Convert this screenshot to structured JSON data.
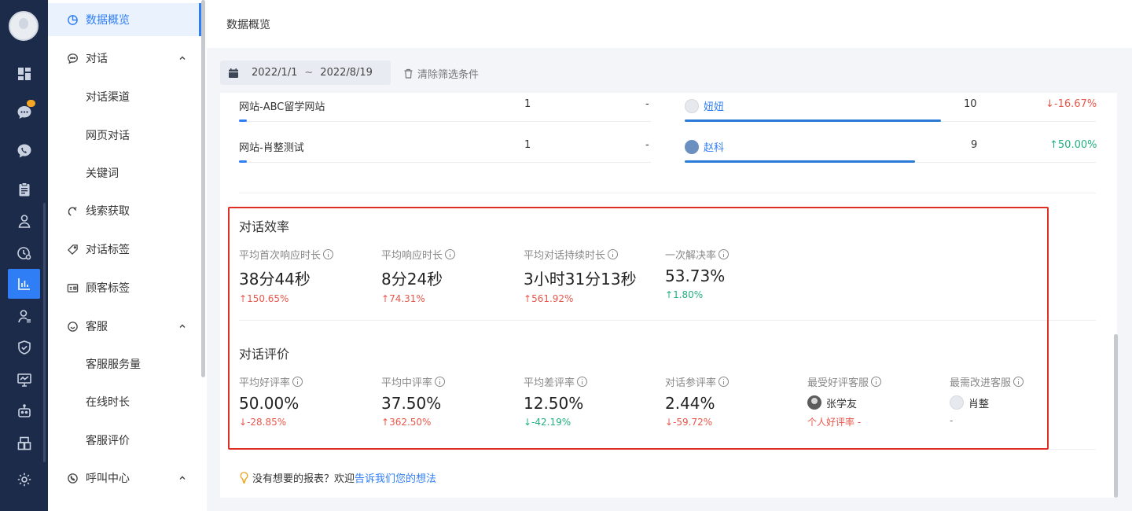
{
  "page": {
    "title": "数据概览"
  },
  "rail": {
    "icons": [
      "dashboard-icon",
      "chat-icon",
      "phone-icon",
      "clipboard-icon",
      "user-icon",
      "clock-icon",
      "stats-icon",
      "contact-icon",
      "shield-icon",
      "monitor-icon",
      "robot-icon",
      "apps-icon",
      "gear-icon"
    ],
    "active": "stats-icon",
    "accent": "#2f7ef5"
  },
  "subnav": {
    "items": [
      {
        "label": "数据概览",
        "type": "item",
        "icon": "pie-chart-icon",
        "active": true
      },
      {
        "label": "对话",
        "type": "group",
        "icon": "chat-bubble-icon",
        "expanded": true
      },
      {
        "label": "对话渠道",
        "type": "sub"
      },
      {
        "label": "网页对话",
        "type": "sub"
      },
      {
        "label": "关键词",
        "type": "sub"
      },
      {
        "label": "线索获取",
        "type": "item",
        "icon": "magnet-icon"
      },
      {
        "label": "对话标签",
        "type": "item",
        "icon": "tag-icon"
      },
      {
        "label": "顾客标签",
        "type": "item",
        "icon": "id-card-icon"
      },
      {
        "label": "客服",
        "type": "group",
        "icon": "agent-icon",
        "expanded": true
      },
      {
        "label": "客服服务量",
        "type": "sub"
      },
      {
        "label": "在线时长",
        "type": "sub"
      },
      {
        "label": "客服评价",
        "type": "sub"
      },
      {
        "label": "呼叫中心",
        "type": "group",
        "icon": "phone-call-icon",
        "expanded": true
      }
    ]
  },
  "filter": {
    "start_date": "2022/1/1",
    "separator": "~",
    "end_date": "2022/8/19",
    "clear_label": "清除筛选条件"
  },
  "channels": [
    {
      "name": "网站-ABC留学网站",
      "count": "1",
      "change": "-",
      "bar_fraction": 0.02
    },
    {
      "name": "网站-肖整测试",
      "count": "1",
      "change": "-",
      "bar_fraction": 0.02
    }
  ],
  "agents": [
    {
      "name": "妞妞",
      "count": "10",
      "change": "-16.67%",
      "direction": "down",
      "bar_fraction": 1.0
    },
    {
      "name": "赵科",
      "count": "9",
      "change": "50.00%",
      "direction": "up",
      "bar_fraction": 0.9
    }
  ],
  "efficiency": {
    "title": "对话效率",
    "metrics": [
      {
        "label": "平均首次响应时长",
        "value": "38分44秒",
        "delta": "150.65%",
        "direction": "up",
        "color": "#e8574b"
      },
      {
        "label": "平均响应时长",
        "value": "8分24秒",
        "delta": "74.31%",
        "direction": "up",
        "color": "#e8574b"
      },
      {
        "label": "平均对话持续时长",
        "value": "3小时31分13秒",
        "delta": "561.92%",
        "direction": "up",
        "color": "#e8574b"
      },
      {
        "label": "一次解决率",
        "value": "53.73%",
        "delta": "1.80%",
        "direction": "up",
        "color": "#22b07d"
      }
    ]
  },
  "rating": {
    "title": "对话评价",
    "metrics": [
      {
        "label": "平均好评率",
        "value": "50.00%",
        "delta": "-28.85%",
        "direction": "down",
        "color": "#e8574b"
      },
      {
        "label": "平均中评率",
        "value": "37.50%",
        "delta": "362.50%",
        "direction": "up",
        "color": "#e8574b"
      },
      {
        "label": "平均差评率",
        "value": "12.50%",
        "delta": "-42.19%",
        "direction": "down",
        "color": "#22b07d"
      },
      {
        "label": "对话参评率",
        "value": "2.44%",
        "delta": "-59.72%",
        "direction": "down",
        "color": "#e8574b"
      }
    ],
    "best_agent": {
      "label": "最受好评客服",
      "name": "张学友",
      "sub": "个人好评率 -"
    },
    "worst_agent": {
      "label": "最需改进客服",
      "name": "肖整",
      "sub": "-"
    }
  },
  "feedback": {
    "text": "没有想要的报表？欢迎",
    "link": "告诉我们您的想法"
  }
}
